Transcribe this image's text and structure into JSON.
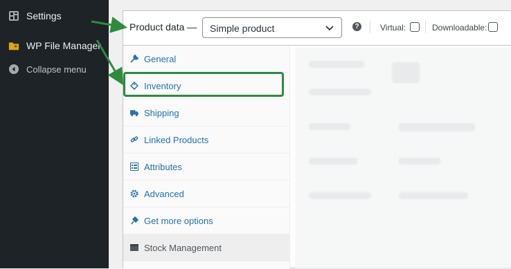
{
  "sidebar": {
    "items": [
      {
        "label": "Settings",
        "icon": "settings-icon"
      },
      {
        "label": "WP File Manager",
        "icon": "file-manager-icon"
      },
      {
        "label": "Collapse menu",
        "icon": "collapse-icon"
      }
    ]
  },
  "product_data": {
    "title": "Product data —",
    "product_type": "Simple product",
    "help": "?",
    "virtual_label": "Virtual:",
    "virtual_checked": false,
    "downloadable_label": "Downloadable:",
    "downloadable_checked": false
  },
  "tabs": [
    {
      "label": "General",
      "icon": "wrench-icon"
    },
    {
      "label": "Inventory",
      "icon": "tag-icon"
    },
    {
      "label": "Shipping",
      "icon": "truck-icon"
    },
    {
      "label": "Linked Products",
      "icon": "link-icon"
    },
    {
      "label": "Attributes",
      "icon": "list-icon"
    },
    {
      "label": "Advanced",
      "icon": "gear-icon"
    },
    {
      "label": "Get more options",
      "icon": "plugin-icon"
    },
    {
      "label": "Stock Management",
      "icon": "box-icon"
    }
  ],
  "colors": {
    "sidebar_bg": "#1d2327",
    "link": "#2271b1",
    "highlight": "#2e8b3e",
    "arrow": "#2e8b3e"
  }
}
